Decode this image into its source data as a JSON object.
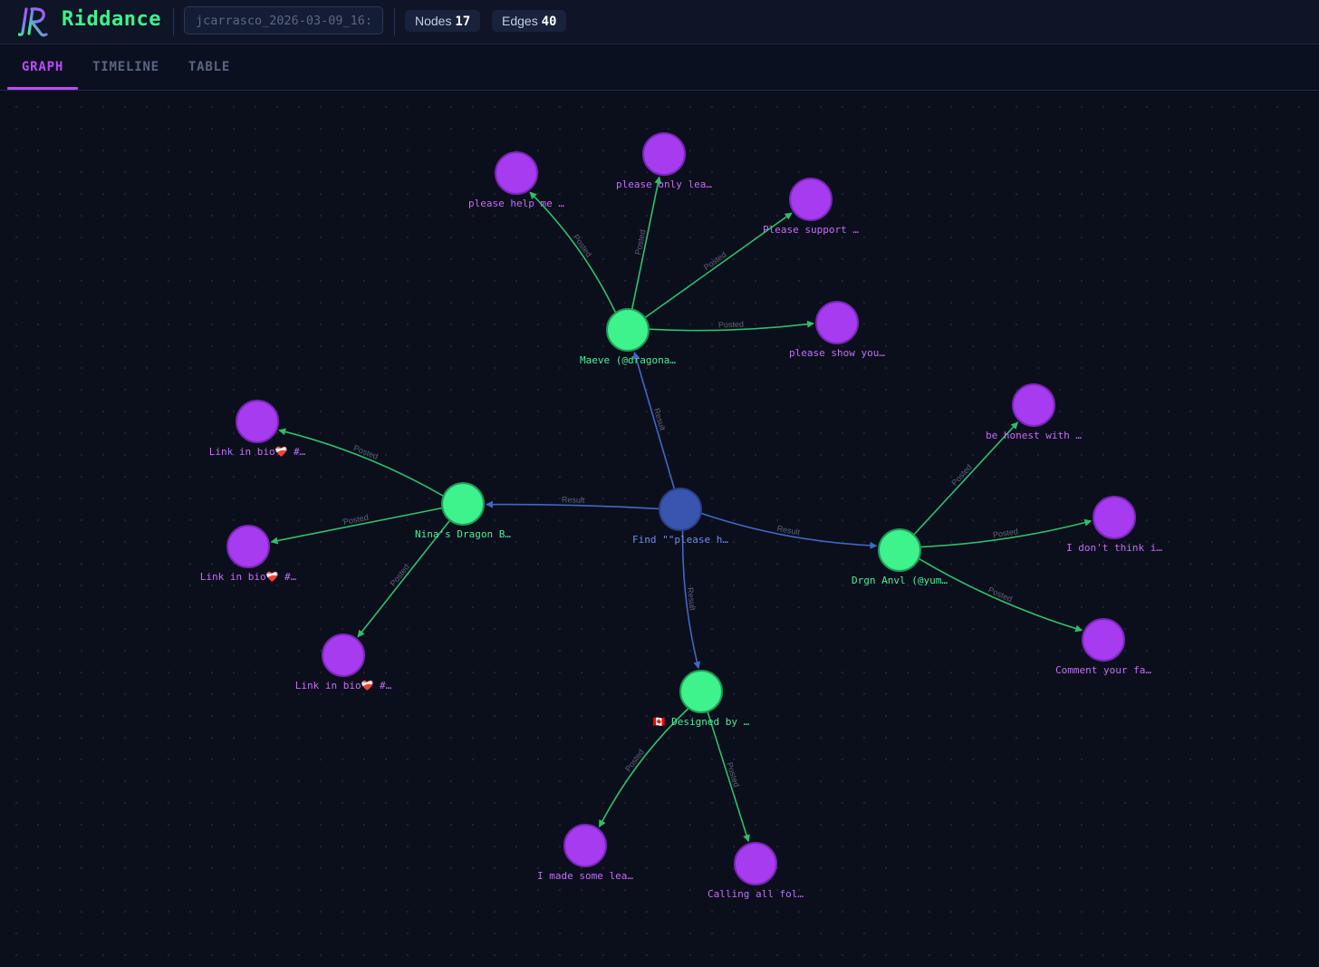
{
  "app": {
    "name": "Riddance",
    "session_value": "jcarrasco_2026-03-09_16:",
    "stats": [
      {
        "label": "Nodes",
        "value": "17"
      },
      {
        "label": "Edges",
        "value": "40"
      }
    ]
  },
  "tabs": [
    {
      "label": "GRAPH",
      "active": true
    },
    {
      "label": "TIMELINE",
      "active": false
    },
    {
      "label": "TABLE",
      "active": false
    }
  ],
  "colors": {
    "query": "#3a55b0",
    "account": "#3ef38c",
    "post": "#a73bf0",
    "result_edge": "#4268c4",
    "posted_edge": "#2fbf6b",
    "accent": "#b94cf6"
  },
  "graph": {
    "nodes": [
      {
        "id": "q",
        "type": "query",
        "label": "Find \"\"please h…"
      },
      {
        "id": "a1",
        "type": "account",
        "label": "Maeve (@dragona…"
      },
      {
        "id": "a2",
        "type": "account",
        "label": "Nina's Dragon B…"
      },
      {
        "id": "a3",
        "type": "account",
        "label": "Drgn Anvl (@yum…"
      },
      {
        "id": "a4",
        "type": "account",
        "label": "🇨🇦 Designed by …"
      },
      {
        "id": "p1",
        "type": "post",
        "label": "please help me …"
      },
      {
        "id": "p2",
        "type": "post",
        "label": "please only lea…"
      },
      {
        "id": "p3",
        "type": "post",
        "label": "Please support …"
      },
      {
        "id": "p4",
        "type": "post",
        "label": "please show you…"
      },
      {
        "id": "p5",
        "type": "post",
        "label": "Link in bio❤️‍🩹 #…"
      },
      {
        "id": "p6",
        "type": "post",
        "label": "Link in bio❤️‍🩹 #…"
      },
      {
        "id": "p7",
        "type": "post",
        "label": "Link in bio❤️‍🩹 #…"
      },
      {
        "id": "p8",
        "type": "post",
        "label": "be honest with …"
      },
      {
        "id": "p9",
        "type": "post",
        "label": "I don't think i…"
      },
      {
        "id": "p10",
        "type": "post",
        "label": "Comment your fa…"
      },
      {
        "id": "p11",
        "type": "post",
        "label": "I made some lea…"
      },
      {
        "id": "p12",
        "type": "post",
        "label": "Calling all fol…"
      }
    ],
    "edges": [
      {
        "from": "q",
        "to": "a1",
        "label": "Result"
      },
      {
        "from": "q",
        "to": "a2",
        "label": "Result"
      },
      {
        "from": "q",
        "to": "a3",
        "label": "Result"
      },
      {
        "from": "q",
        "to": "a4",
        "label": "Result"
      },
      {
        "from": "a1",
        "to": "p1",
        "label": "Posted"
      },
      {
        "from": "a1",
        "to": "p2",
        "label": "Posted"
      },
      {
        "from": "a1",
        "to": "p3",
        "label": "Posted"
      },
      {
        "from": "a1",
        "to": "p4",
        "label": "Posted"
      },
      {
        "from": "a2",
        "to": "p5",
        "label": "Posted"
      },
      {
        "from": "a2",
        "to": "p6",
        "label": "Posted"
      },
      {
        "from": "a2",
        "to": "p7",
        "label": "Posted"
      },
      {
        "from": "a3",
        "to": "p8",
        "label": "Posted"
      },
      {
        "from": "a3",
        "to": "p9",
        "label": "Posted"
      },
      {
        "from": "a3",
        "to": "p10",
        "label": "Posted"
      },
      {
        "from": "a4",
        "to": "p11",
        "label": "Posted"
      },
      {
        "from": "a4",
        "to": "p12",
        "label": "Posted"
      }
    ]
  }
}
